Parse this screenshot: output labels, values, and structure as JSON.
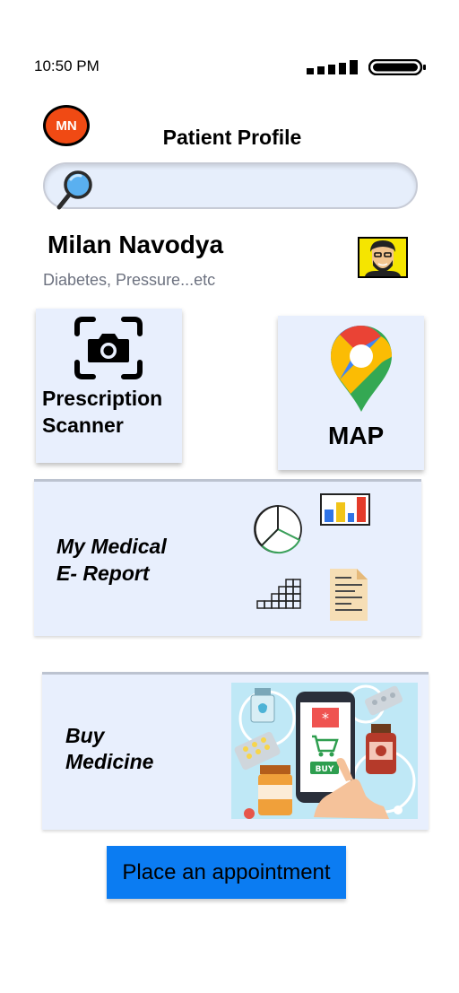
{
  "status": {
    "time": "10:50 PM"
  },
  "header": {
    "avatar_initials": "MN",
    "title": "Patient Profile"
  },
  "search": {
    "placeholder": ""
  },
  "patient": {
    "name": "Milan Navodya",
    "conditions": "Diabetes, Pressure...etc"
  },
  "cards": {
    "scanner_label": "Prescription Scanner",
    "map_label": "MAP",
    "report_label": "My Medical\nE- Report",
    "medicine_label": "Buy\nMedicine",
    "medicine_buy_tag": "BUY"
  },
  "appointment_button": "Place an appointment",
  "icons": {
    "search": "magnifier-icon",
    "camera": "camera-scan-icon",
    "map": "map-pin-icon",
    "pie": "pie-chart-icon",
    "bar": "bar-chart-icon",
    "stairs": "stair-chart-icon",
    "document": "document-icon"
  },
  "colors": {
    "avatar": "#f04a14",
    "card": "#e8effd",
    "button": "#0b7cf2",
    "photo_bg": "#f5e500"
  }
}
